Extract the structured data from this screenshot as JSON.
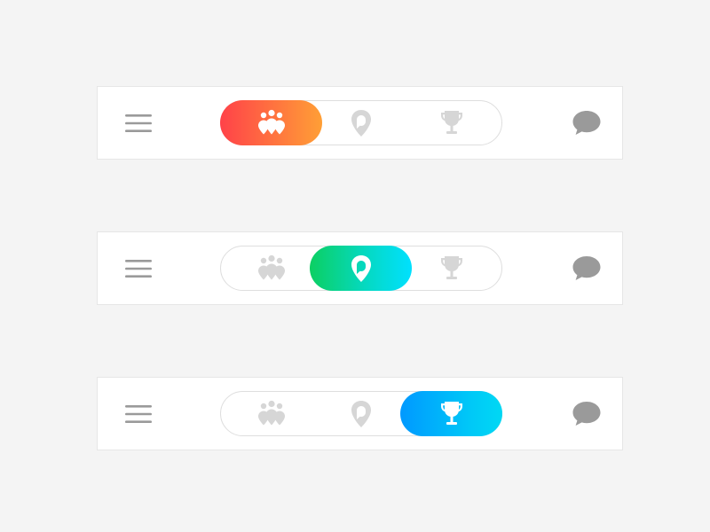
{
  "colors": {
    "background": "#f4f4f4",
    "bar_background": "#ffffff",
    "icon_inactive": "#d6d6d6",
    "icon_muted": "#9a9a9a",
    "icon_active": "#ffffff",
    "gradient_orange": [
      "#ff4249",
      "#ff9f36"
    ],
    "gradient_green": [
      "#0ccf62",
      "#00e0ff"
    ],
    "gradient_blue": [
      "#0099ff",
      "#00d8f4"
    ]
  },
  "bars": [
    {
      "left_icon": "hamburger-menu-icon",
      "right_icon": "chat-bubble-icon",
      "segments": [
        {
          "icon": "people-pins-icon",
          "active": true
        },
        {
          "icon": "location-pin-icon",
          "active": false
        },
        {
          "icon": "trophy-icon",
          "active": false
        }
      ]
    },
    {
      "left_icon": "hamburger-menu-icon",
      "right_icon": "chat-bubble-icon",
      "segments": [
        {
          "icon": "people-pins-icon",
          "active": false
        },
        {
          "icon": "location-pin-icon",
          "active": true
        },
        {
          "icon": "trophy-icon",
          "active": false
        }
      ]
    },
    {
      "left_icon": "hamburger-menu-icon",
      "right_icon": "chat-bubble-icon",
      "segments": [
        {
          "icon": "people-pins-icon",
          "active": false
        },
        {
          "icon": "location-pin-icon",
          "active": false
        },
        {
          "icon": "trophy-icon",
          "active": true
        }
      ]
    }
  ]
}
